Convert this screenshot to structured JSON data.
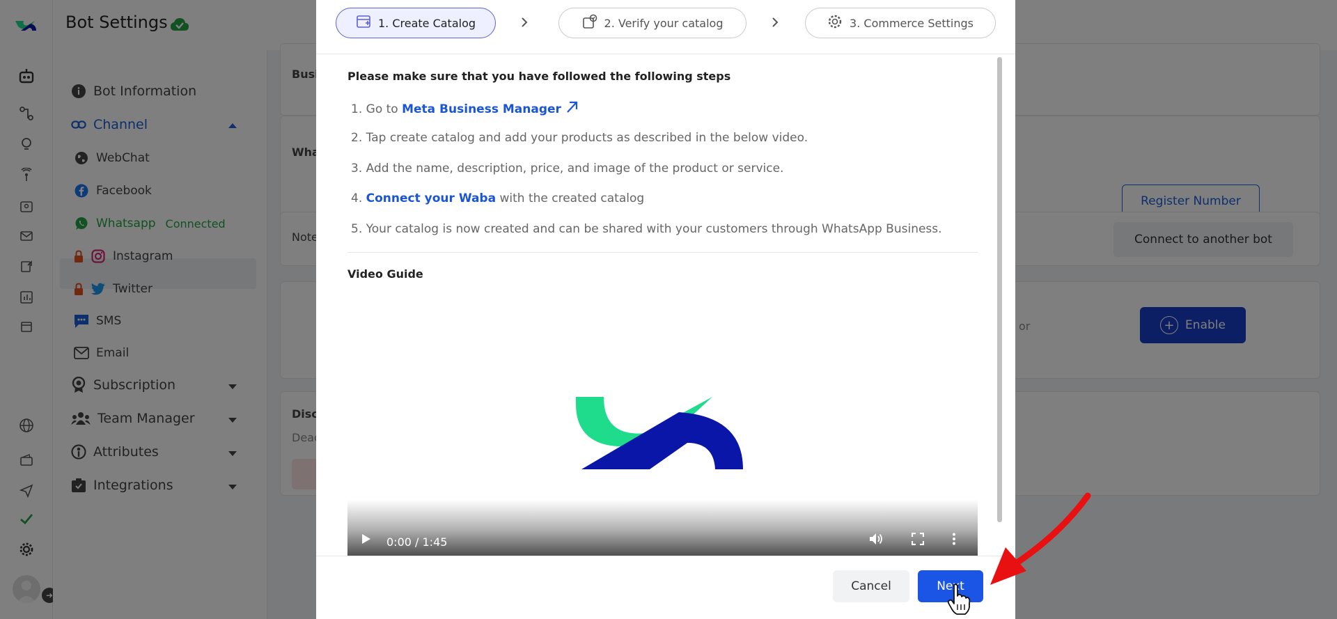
{
  "header": {
    "title": "Bot Settings"
  },
  "sidebar": {
    "items": [
      {
        "label": "Bot Information"
      },
      {
        "label": "Channel"
      },
      {
        "label": "WebChat"
      },
      {
        "label": "Facebook"
      },
      {
        "label": "Whatsapp",
        "status": "Connected"
      },
      {
        "label": "Instagram"
      },
      {
        "label": "Twitter"
      },
      {
        "label": "SMS"
      },
      {
        "label": "Email"
      },
      {
        "label": "Subscription"
      },
      {
        "label": "Team Manager"
      },
      {
        "label": "Attributes"
      },
      {
        "label": "Integrations"
      }
    ]
  },
  "background": {
    "card1_label": "Busi",
    "card2_label": "Wha",
    "register_button": "Register Number",
    "card3_label": "Note",
    "connect_button": "Connect to another bot",
    "card4_fragment": "or",
    "enable_button": "Enable",
    "card5_label": "Disc",
    "card5_sub": "Deac"
  },
  "modal": {
    "steps": [
      {
        "label": "1. Create Catalog"
      },
      {
        "label": "2. Verify your catalog"
      },
      {
        "label": "3. Commerce Settings"
      }
    ],
    "intro": "Please make sure that you have followed the following steps",
    "list": [
      {
        "num": "1.",
        "pre": "Go to",
        "link": "Meta Business Manager",
        "post": ""
      },
      {
        "num": "2.",
        "pre": "Tap create catalog and add your products as described in the below video.",
        "link": "",
        "post": ""
      },
      {
        "num": "3.",
        "pre": "Add the name, description, price, and image of the product or service.",
        "link": "",
        "post": ""
      },
      {
        "num": "4.",
        "pre": "",
        "link": "Connect your Waba",
        "post": "with the created catalog"
      },
      {
        "num": "5.",
        "pre": "Your catalog is now created and can be shared with your customers through WhatsApp Business.",
        "link": "",
        "post": ""
      }
    ],
    "video_title": "Video Guide",
    "video": {
      "time": "0:00 / 1:45"
    },
    "cancel": "Cancel",
    "next": "Next"
  },
  "colors": {
    "accent": "#1a55e6",
    "whatsapp_green": "#25a244",
    "logo_green": "#1fdc8c",
    "logo_blue": "#0a16a8",
    "annotation_red": "#e81010"
  }
}
